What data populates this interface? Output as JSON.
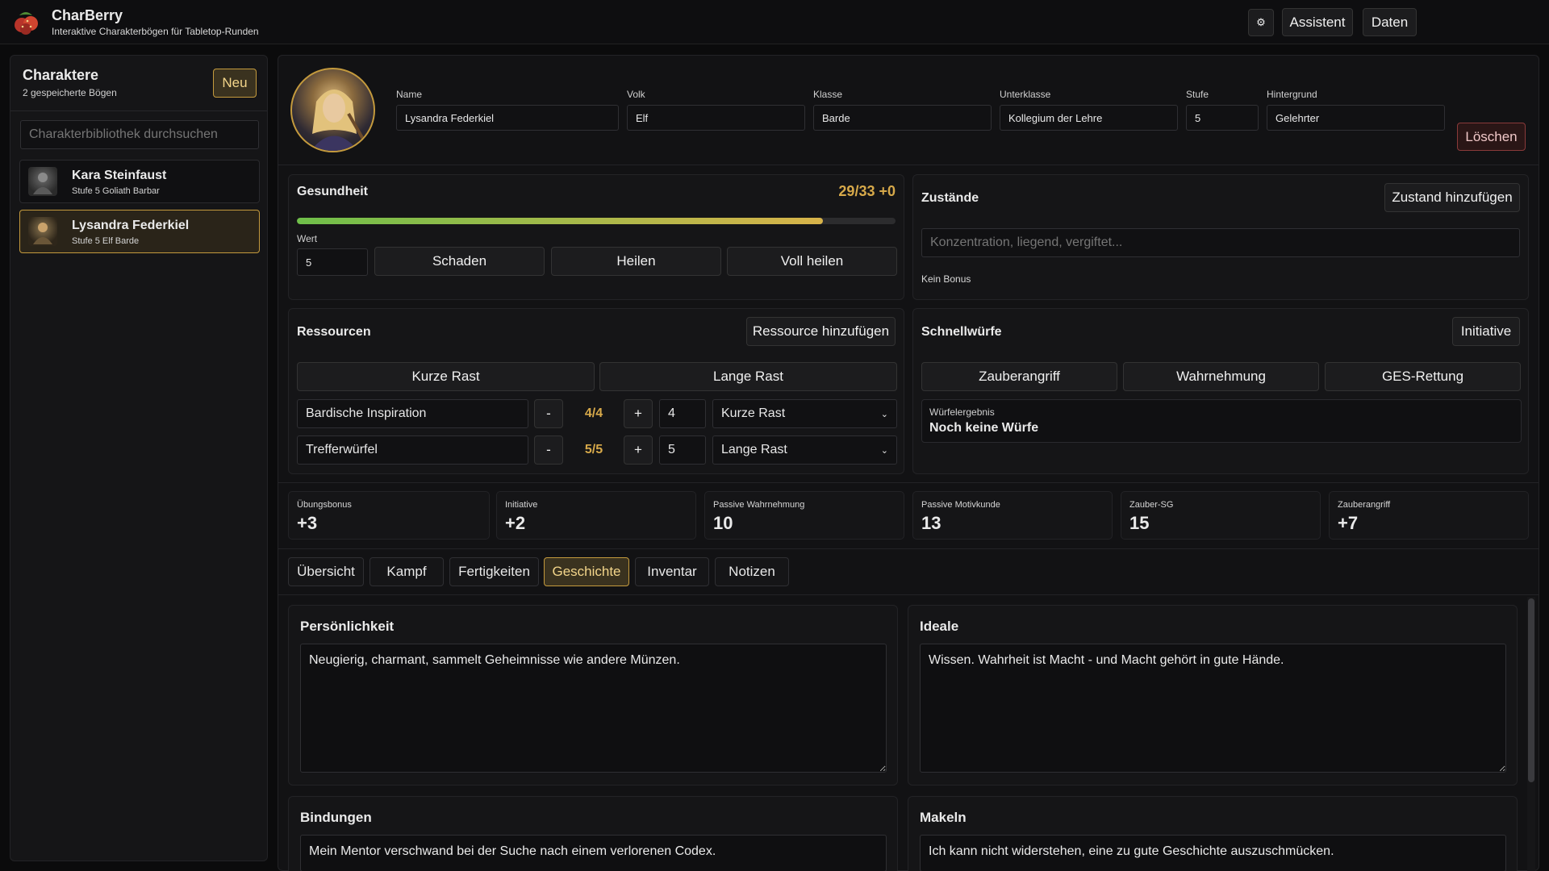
{
  "header": {
    "app_name": "CharBerry",
    "subtitle": "Interaktive Charakterbögen für Tabletop-Runden",
    "settings_icon": "gear-icon",
    "assistant_label": "Assistent",
    "data_label": "Daten"
  },
  "sidebar": {
    "title": "Charaktere",
    "count": "2 gespeicherte Bögen",
    "new_label": "Neu",
    "search_placeholder": "Charakterbibliothek durchsuchen",
    "characters": [
      {
        "name": "Kara Steinfaust",
        "desc": "Stufe 5 Goliath Barbar"
      },
      {
        "name": "Lysandra Federkiel",
        "desc": "Stufe 5 Elf Barde"
      }
    ]
  },
  "profile": {
    "fields": [
      {
        "label": "Name",
        "value": "Lysandra Federkiel"
      },
      {
        "label": "Volk",
        "value": "Elf"
      },
      {
        "label": "Klasse",
        "value": "Barde"
      },
      {
        "label": "Unterklasse",
        "value": "Kollegium der Lehre"
      },
      {
        "label": "Stufe",
        "value": "5"
      },
      {
        "label": "Hintergrund",
        "value": "Gelehrter"
      }
    ],
    "delete_label": "Löschen"
  },
  "health": {
    "title": "Gesundheit",
    "display": "29/33 +0",
    "fraction": 0.879,
    "value_label": "Wert",
    "value": "5",
    "damage_label": "Schaden",
    "heal_label": "Heilen",
    "full_heal_label": "Voll heilen"
  },
  "conditions": {
    "title": "Zustände",
    "add_label": "Zustand hinzufügen",
    "placeholder": "Konzentration, liegend, vergiftet...",
    "bonus_text": "Kein Bonus"
  },
  "resources": {
    "title": "Ressourcen",
    "add_label": "Ressource hinzufügen",
    "short_rest_label": "Kurze Rast",
    "long_rest_label": "Lange Rast",
    "items": [
      {
        "name": "Bardische Inspiration",
        "minus": "-",
        "count": "4/4",
        "plus": "+",
        "max": "4",
        "reset": "Kurze Rast"
      },
      {
        "name": "Trefferwürfel",
        "minus": "-",
        "count": "5/5",
        "plus": "+",
        "max": "5",
        "reset": "Lange Rast"
      }
    ]
  },
  "quickrolls": {
    "title": "Schnellwürfe",
    "initiative_label": "Initiative",
    "buttons": [
      "Zauberangriff",
      "Wahrnehmung",
      "GES-Rettung"
    ],
    "result_label": "Würfelergebnis",
    "result_value": "Noch keine Würfe"
  },
  "stats": [
    {
      "label": "Übungsbonus",
      "value": "+3"
    },
    {
      "label": "Initiative",
      "value": "+2"
    },
    {
      "label": "Passive Wahrnehmung",
      "value": "10"
    },
    {
      "label": "Passive Motivkunde",
      "value": "13"
    },
    {
      "label": "Zauber-SG",
      "value": "15"
    },
    {
      "label": "Zauberangriff",
      "value": "+7"
    }
  ],
  "tabs": [
    "Übersicht",
    "Kampf",
    "Fertigkeiten",
    "Geschichte",
    "Inventar",
    "Notizen"
  ],
  "story": {
    "personality": {
      "title": "Persönlichkeit",
      "text": "Neugierig, charmant, sammelt Geheimnisse wie andere Münzen."
    },
    "ideals": {
      "title": "Ideale",
      "text": "Wissen. Wahrheit ist Macht - und Macht gehört in gute Hände."
    },
    "bonds": {
      "title": "Bindungen",
      "text": "Mein Mentor verschwand bei der Suche nach einem verlorenen Codex."
    },
    "flaws": {
      "title": "Makeln",
      "text": "Ich kann nicht widerstehen, eine zu gute Geschichte auszuschmücken."
    }
  },
  "colors": {
    "accent": "#d7a94a",
    "health_start": "#6fbf4a",
    "health_end": "#d8b34a"
  }
}
